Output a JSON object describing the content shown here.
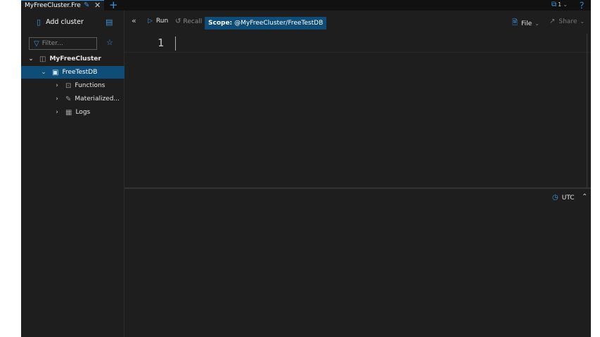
{
  "tab": {
    "title": "MyFreeCluster.Fre...",
    "edit_icon": "pencil-icon",
    "close_icon": "close-icon",
    "add_icon": "plus-icon"
  },
  "titlebar_right": {
    "count": "1",
    "copy_icon": "copy-icon",
    "help_icon": "help-icon"
  },
  "sidebar": {
    "add_cluster_label": "Add cluster",
    "filter_placeholder": "Filter...",
    "tree": [
      {
        "label": "MyFreeCluster",
        "icon": "cluster-icon",
        "expanded": true
      },
      {
        "label": "FreeTestDB",
        "icon": "database-icon",
        "expanded": true,
        "selected": true
      },
      {
        "label": "Functions",
        "icon": "function-icon",
        "expanded": false
      },
      {
        "label": "Materialized...",
        "icon": "materialized-view-icon",
        "expanded": false
      },
      {
        "label": "Logs",
        "icon": "table-icon",
        "expanded": false
      }
    ]
  },
  "toolbar": {
    "run_label": "Run",
    "recall_label": "Recall",
    "scope_prefix": "Scope:",
    "scope_value": "@MyFreeCluster/FreeTestDB",
    "file_label": "File",
    "share_label": "Share"
  },
  "editor": {
    "line_number": "1",
    "content": ""
  },
  "results": {
    "timezone_label": "UTC"
  },
  "colors": {
    "accent": "#3a96dd",
    "selection": "#0e4d78",
    "background": "#1e1e1e"
  }
}
